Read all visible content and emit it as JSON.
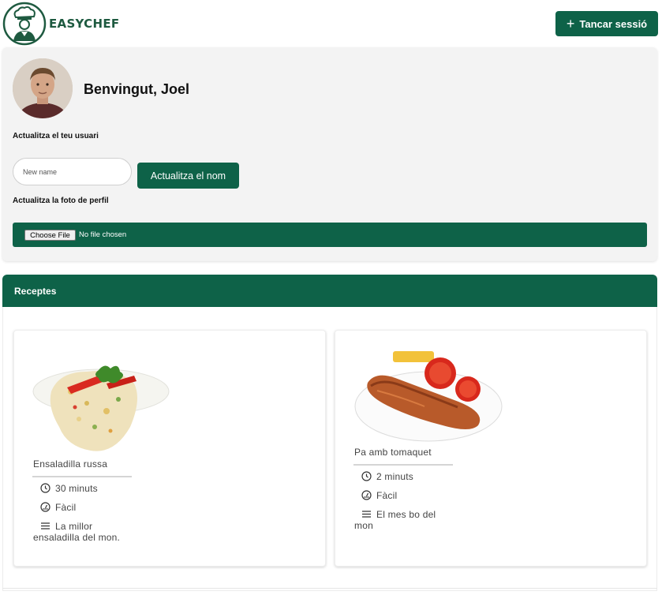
{
  "header": {
    "brand": "EASYCHEF",
    "logout_label": "Tancar sessió"
  },
  "profile": {
    "welcome": "Benvingut, Joel",
    "update_user_label": "Actualitza el teu usuari",
    "name_placeholder": "New name",
    "update_name_button": "Actualitza el nom",
    "update_photo_label": "Actualitza la foto de perfil",
    "choose_file_button": "Choose File",
    "no_file_text": "No file chosen"
  },
  "recipes": {
    "title": "Receptes",
    "items": [
      {
        "name": "Ensaladilla russa",
        "time": "30 minuts",
        "difficulty": "Fàcil",
        "description_line1": "La millor",
        "description_line2": "ensaladilla del mon."
      },
      {
        "name": "Pa amb tomaquet",
        "time": "2 minuts",
        "difficulty": "Fàcil",
        "description_line1": "El mes bo del",
        "description_line2": "mon"
      }
    ]
  },
  "colors": {
    "accent": "#0e6248",
    "panel_bg": "#f3f3f3"
  },
  "icons": [
    "chef-logo-icon",
    "plus-icon",
    "clock-icon",
    "difficulty-gauge-icon",
    "menu-lines-icon"
  ]
}
